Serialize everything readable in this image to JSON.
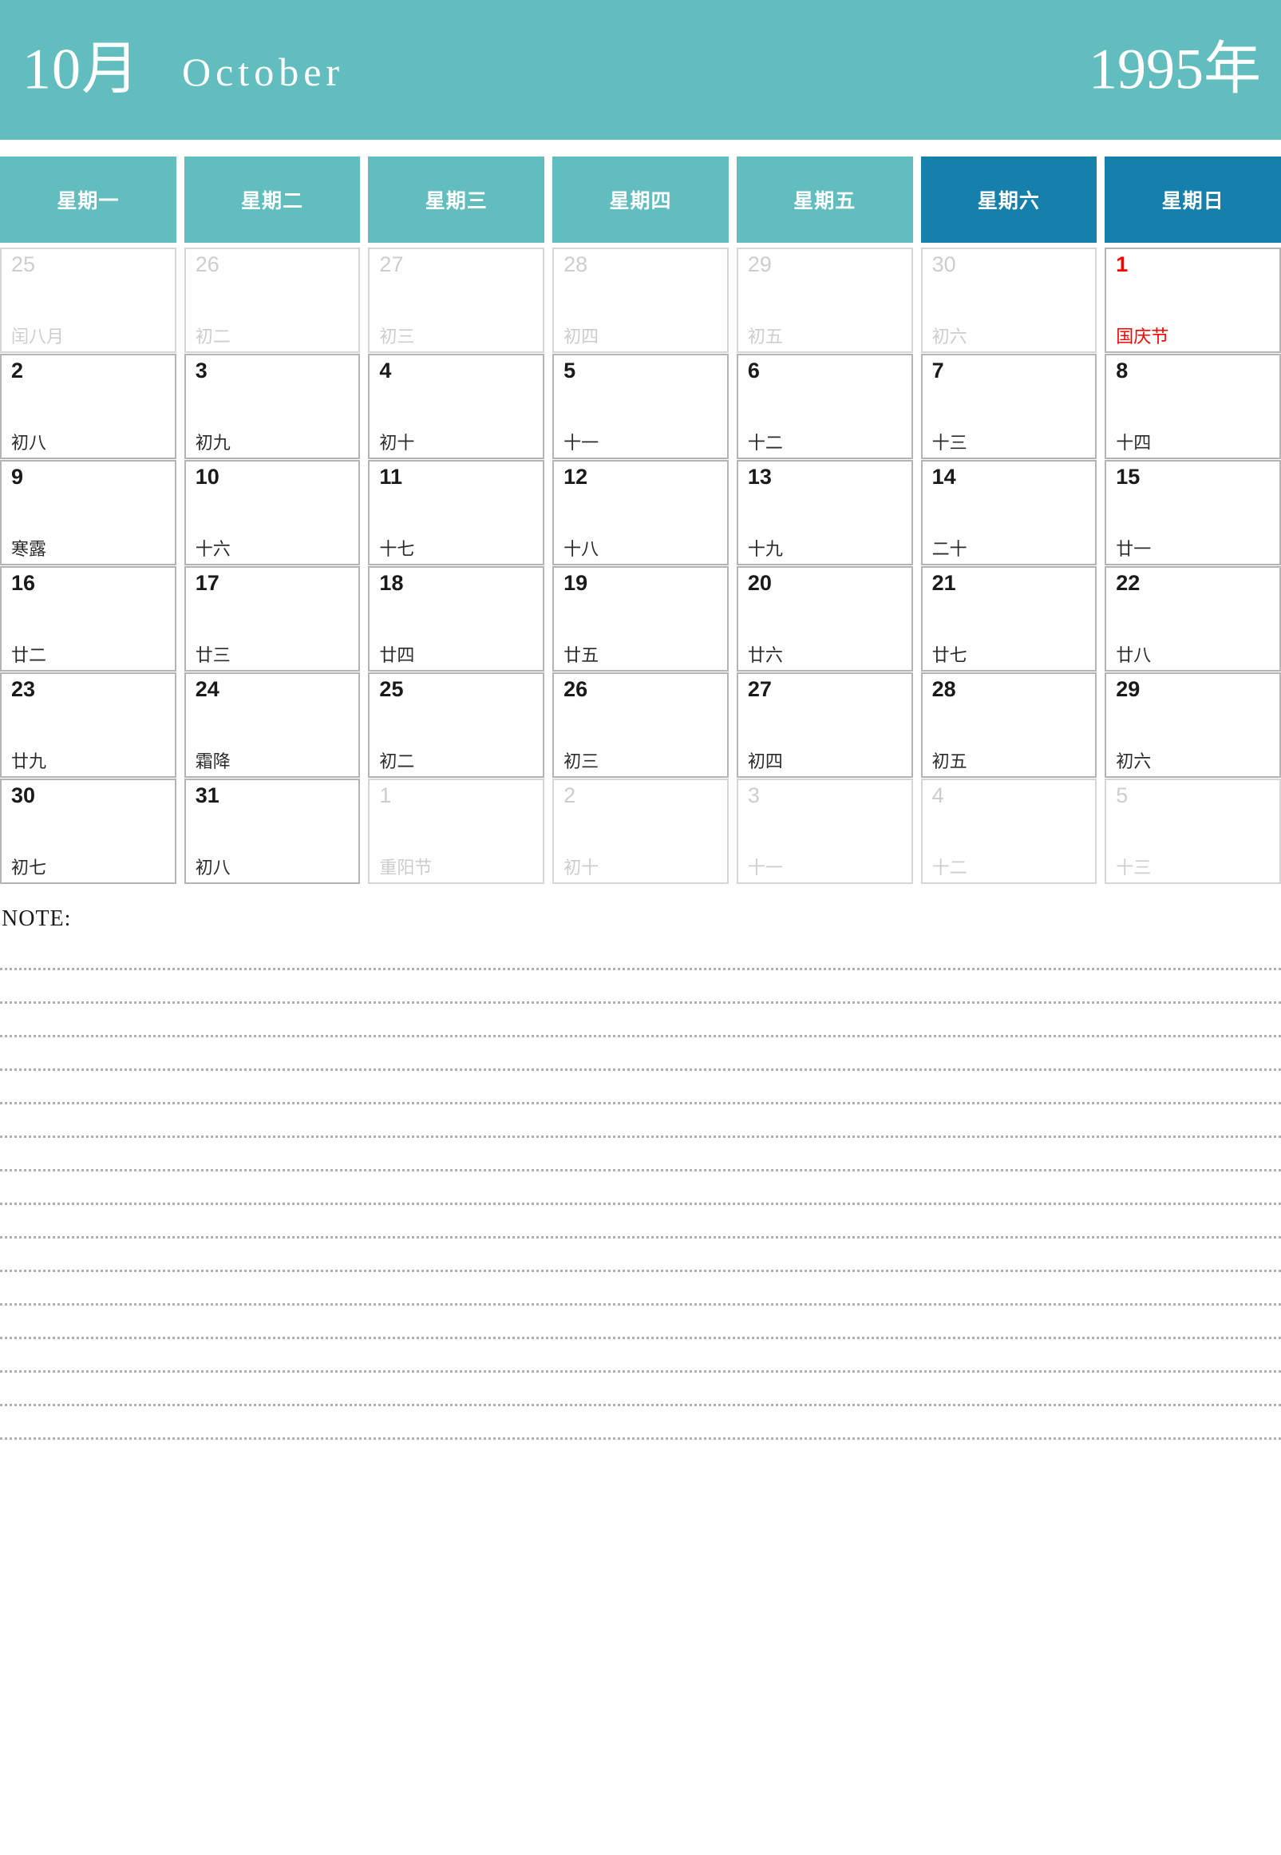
{
  "header": {
    "month_cn": "10月",
    "month_en": "October",
    "year": "1995年",
    "banner_color": "#62bdbe",
    "weekend_color": "#1580ac"
  },
  "weekdays": [
    {
      "label": "星期一",
      "weekend": false
    },
    {
      "label": "星期二",
      "weekend": false
    },
    {
      "label": "星期三",
      "weekend": false
    },
    {
      "label": "星期四",
      "weekend": false
    },
    {
      "label": "星期五",
      "weekend": false
    },
    {
      "label": "星期六",
      "weekend": true
    },
    {
      "label": "星期日",
      "weekend": true
    }
  ],
  "weeks": [
    [
      {
        "num": "25",
        "lunar": "闰八月",
        "muted": true,
        "holiday": false
      },
      {
        "num": "26",
        "lunar": "初二",
        "muted": true,
        "holiday": false
      },
      {
        "num": "27",
        "lunar": "初三",
        "muted": true,
        "holiday": false
      },
      {
        "num": "28",
        "lunar": "初四",
        "muted": true,
        "holiday": false
      },
      {
        "num": "29",
        "lunar": "初五",
        "muted": true,
        "holiday": false
      },
      {
        "num": "30",
        "lunar": "初六",
        "muted": true,
        "holiday": false
      },
      {
        "num": "1",
        "lunar": "国庆节",
        "muted": false,
        "holiday": true
      }
    ],
    [
      {
        "num": "2",
        "lunar": "初八",
        "muted": false,
        "holiday": false
      },
      {
        "num": "3",
        "lunar": "初九",
        "muted": false,
        "holiday": false
      },
      {
        "num": "4",
        "lunar": "初十",
        "muted": false,
        "holiday": false
      },
      {
        "num": "5",
        "lunar": "十一",
        "muted": false,
        "holiday": false
      },
      {
        "num": "6",
        "lunar": "十二",
        "muted": false,
        "holiday": false
      },
      {
        "num": "7",
        "lunar": "十三",
        "muted": false,
        "holiday": false
      },
      {
        "num": "8",
        "lunar": "十四",
        "muted": false,
        "holiday": false
      }
    ],
    [
      {
        "num": "9",
        "lunar": "寒露",
        "muted": false,
        "holiday": false
      },
      {
        "num": "10",
        "lunar": "十六",
        "muted": false,
        "holiday": false
      },
      {
        "num": "11",
        "lunar": "十七",
        "muted": false,
        "holiday": false
      },
      {
        "num": "12",
        "lunar": "十八",
        "muted": false,
        "holiday": false
      },
      {
        "num": "13",
        "lunar": "十九",
        "muted": false,
        "holiday": false
      },
      {
        "num": "14",
        "lunar": "二十",
        "muted": false,
        "holiday": false
      },
      {
        "num": "15",
        "lunar": "廿一",
        "muted": false,
        "holiday": false
      }
    ],
    [
      {
        "num": "16",
        "lunar": "廿二",
        "muted": false,
        "holiday": false
      },
      {
        "num": "17",
        "lunar": "廿三",
        "muted": false,
        "holiday": false
      },
      {
        "num": "18",
        "lunar": "廿四",
        "muted": false,
        "holiday": false
      },
      {
        "num": "19",
        "lunar": "廿五",
        "muted": false,
        "holiday": false
      },
      {
        "num": "20",
        "lunar": "廿六",
        "muted": false,
        "holiday": false
      },
      {
        "num": "21",
        "lunar": "廿七",
        "muted": false,
        "holiday": false
      },
      {
        "num": "22",
        "lunar": "廿八",
        "muted": false,
        "holiday": false
      }
    ],
    [
      {
        "num": "23",
        "lunar": "廿九",
        "muted": false,
        "holiday": false
      },
      {
        "num": "24",
        "lunar": "霜降",
        "muted": false,
        "holiday": false
      },
      {
        "num": "25",
        "lunar": "初二",
        "muted": false,
        "holiday": false
      },
      {
        "num": "26",
        "lunar": "初三",
        "muted": false,
        "holiday": false
      },
      {
        "num": "27",
        "lunar": "初四",
        "muted": false,
        "holiday": false
      },
      {
        "num": "28",
        "lunar": "初五",
        "muted": false,
        "holiday": false
      },
      {
        "num": "29",
        "lunar": "初六",
        "muted": false,
        "holiday": false
      }
    ],
    [
      {
        "num": "30",
        "lunar": "初七",
        "muted": false,
        "holiday": false
      },
      {
        "num": "31",
        "lunar": "初八",
        "muted": false,
        "holiday": false
      },
      {
        "num": "1",
        "lunar": "重阳节",
        "muted": true,
        "holiday": false
      },
      {
        "num": "2",
        "lunar": "初十",
        "muted": true,
        "holiday": false
      },
      {
        "num": "3",
        "lunar": "十一",
        "muted": true,
        "holiday": false
      },
      {
        "num": "4",
        "lunar": "十二",
        "muted": true,
        "holiday": false
      },
      {
        "num": "5",
        "lunar": "十三",
        "muted": true,
        "holiday": false
      }
    ]
  ],
  "note": {
    "label": "NOTE:",
    "line_count": 15
  }
}
